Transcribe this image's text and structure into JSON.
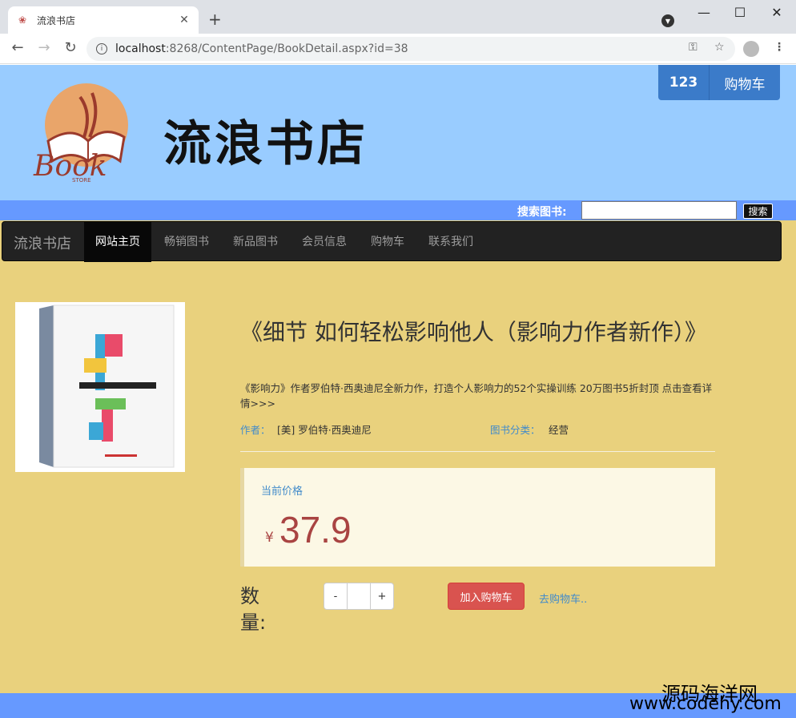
{
  "browser": {
    "tab_title": "流浪书店",
    "tab_favicon": "book-favicon",
    "new_tab": "+",
    "url_host": "localhost",
    "url_rest": ":8268/ContentPage/BookDetail.aspx?id=38",
    "win_min": "—",
    "win_max": "☐",
    "win_close": "✕"
  },
  "header": {
    "site_title": "流浪书店",
    "cart_count": "123",
    "cart_label": "购物车"
  },
  "search": {
    "label": "搜索图书:",
    "value": "",
    "button": "搜索"
  },
  "navbar": {
    "brand": "流浪书店",
    "items": [
      {
        "label": "网站主页",
        "active": true
      },
      {
        "label": "畅销图书",
        "active": false
      },
      {
        "label": "新品图书",
        "active": false
      },
      {
        "label": "会员信息",
        "active": false
      },
      {
        "label": "购物车",
        "active": false
      },
      {
        "label": "联系我们",
        "active": false
      }
    ]
  },
  "book": {
    "title": "《细节 如何轻松影响他人（影响力作者新作）》",
    "description": "《影响力》作者罗伯特·西奥迪尼全新力作，打造个人影响力的52个实操训练 20万图书5折封顶 点击查看详情>>>",
    "author_label": "作者：",
    "author": "[美] 罗伯特·西奥迪尼",
    "category_label": "图书分类：",
    "category": "经营",
    "price_label": "当前价格",
    "currency": "¥",
    "price": "37.9",
    "qty_label": "数量:",
    "qty_minus": "-",
    "qty_value": "",
    "qty_plus": "+",
    "add_cart": "加入购物车",
    "go_cart": "去购物车.."
  },
  "watermark": {
    "line1": "源码海洋网",
    "line2": "www.codehy.com"
  },
  "colors": {
    "banner": "#99ccff",
    "search_bar": "#6699ff",
    "page_bg": "#e9d17d",
    "navbar": "#222222",
    "price": "#a94442",
    "link": "#428bca",
    "add_cart": "#d9534f"
  }
}
